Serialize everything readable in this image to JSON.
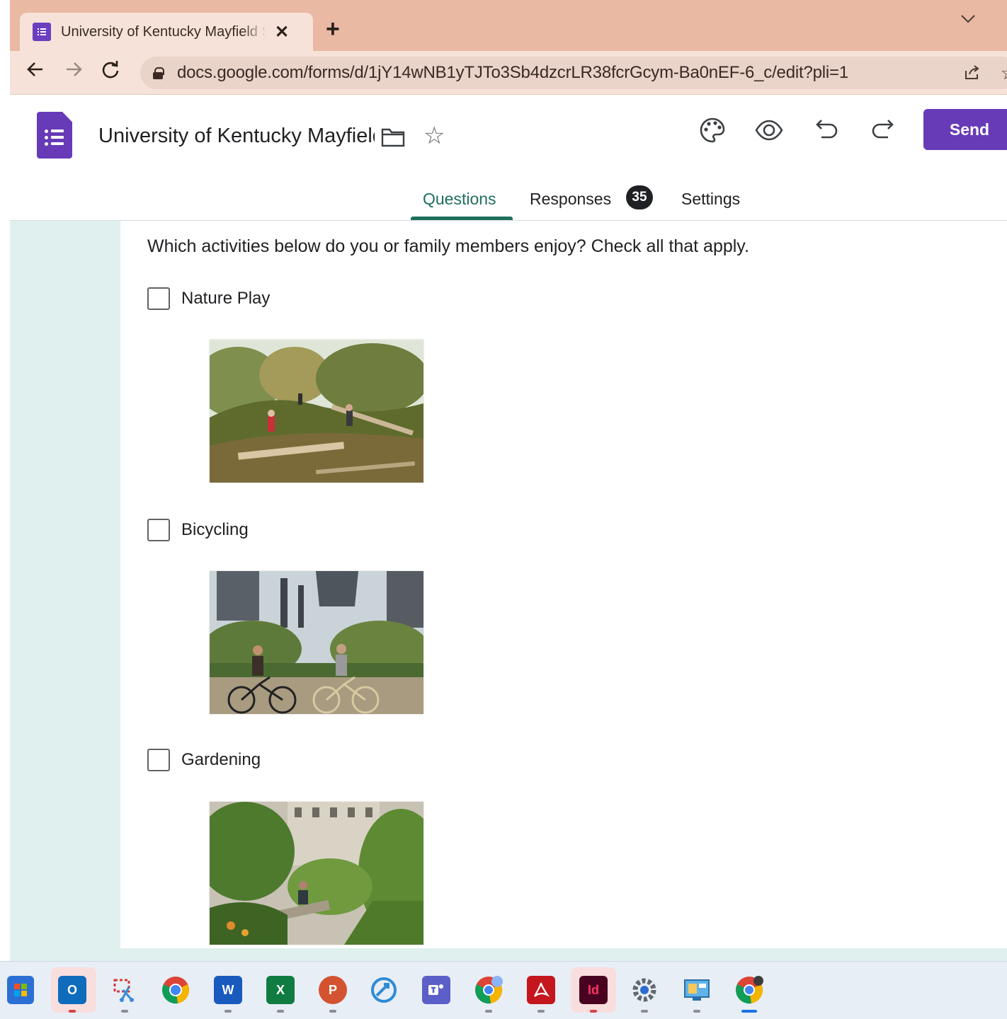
{
  "browser": {
    "tab_title": "University of Kentucky Mayfield Sch",
    "tab_close": "✕",
    "new_tab": "+",
    "url": "docs.google.com/forms/d/1jY14wNB1yTJTo3Sb4dzcrLR38fcrGcym-Ba0nEF-6_c/edit?pli=1"
  },
  "forms": {
    "title": "University of Kentucky Mayfield",
    "send_label": "Send",
    "tabs": [
      {
        "label": "Questions"
      },
      {
        "label": "Responses"
      },
      {
        "label": "Settings"
      }
    ],
    "responses_count": "35"
  },
  "question": {
    "text": "Which activities below do you or family members enjoy? Check all that apply.",
    "options": [
      {
        "label": "Nature Play",
        "checked": false
      },
      {
        "label": "Bicycling",
        "checked": false
      },
      {
        "label": "Gardening",
        "checked": false
      }
    ]
  },
  "colors": {
    "accent": "#673ab7",
    "active_tab": "#1e6f5c",
    "canvas_bg": "#dff0ef",
    "chrome_tab_bar": "#e9b9a4"
  },
  "taskbar": {
    "apps": [
      "start-icon",
      "outlook-icon",
      "snipping-tool-icon",
      "chrome-icon",
      "word-icon",
      "excel-icon",
      "powerpoint-icon",
      "remote-desktop-icon",
      "teams-icon",
      "chrome-profile-icon",
      "acrobat-icon",
      "indesign-icon",
      "settings-icon",
      "control-panel-icon",
      "chrome-active-icon"
    ],
    "word_letter": "W",
    "excel_letter": "X",
    "powerpoint_letter": "P",
    "indesign_letter": "Id",
    "outlook_letter": "O"
  }
}
